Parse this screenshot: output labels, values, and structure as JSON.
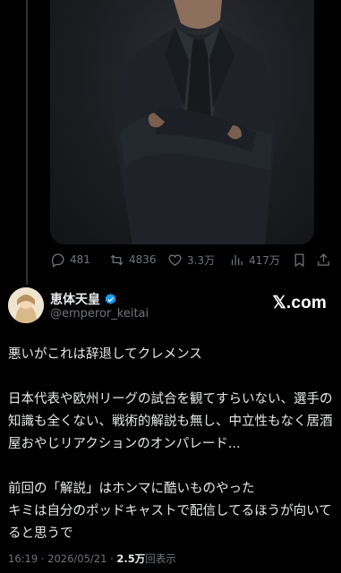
{
  "tweet": {
    "actions": {
      "replies": "481",
      "reposts": "4836",
      "likes": "3.3万",
      "views": "417万"
    },
    "author": {
      "name": "恵体天皇",
      "handle": "@emperor_keitai",
      "verified": true
    },
    "site_label": "𝕏.com",
    "text_lines": [
      "悪いがこれは辞退してクレメンス",
      "",
      "日本代表や欧州リーグの試合を観てすらいない、選手の",
      "知識も全くない、戦術的解説も無し、中立性もなく居酒",
      "屋おやじリアクションのオンパレード...",
      "",
      "前回の「解説」はホンマに酷いものやった",
      "キミは自分のポッドキャストで配信してるほうが向いて",
      "ると思うで"
    ],
    "time": "16:19",
    "dot": "·",
    "date": "2026/05/21",
    "view_count": "2.5万",
    "view_label": "回表示"
  },
  "icons": [
    "reply-icon",
    "repost-icon",
    "like-icon",
    "views-icon",
    "bookmark-icon",
    "share-icon",
    "verified-badge-icon"
  ],
  "colors": {
    "background": "#000000",
    "text": "#e7e9ea",
    "secondary": "#71767b",
    "verified": "#1d9bf0"
  }
}
